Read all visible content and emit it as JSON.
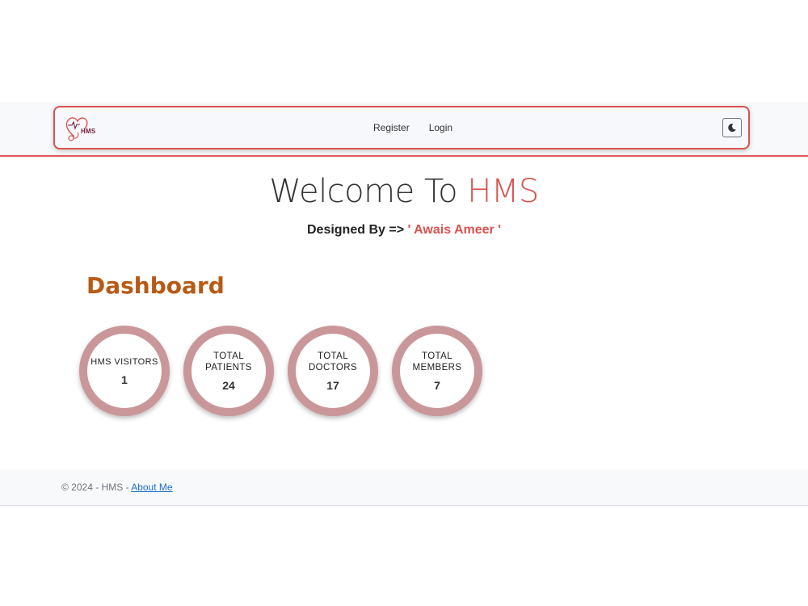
{
  "navbar": {
    "brand_text": "HMS",
    "links": [
      "Register",
      "Login"
    ],
    "theme_toggle_icon": "moon-icon"
  },
  "hero": {
    "welcome_prefix": "Welcome To ",
    "welcome_highlight": "HMS",
    "designed_prefix": "Designed By => ",
    "designed_name": "' Awais Ameer '"
  },
  "dashboard": {
    "title": "Dashboard",
    "stats": [
      {
        "label": "HMS VISITORS",
        "value": "1"
      },
      {
        "label": "TOTAL PATIENTS",
        "value": "24"
      },
      {
        "label": "TOTAL DOCTORS",
        "value": "17"
      },
      {
        "label": "TOTAL MEMBERS",
        "value": "7"
      }
    ]
  },
  "footer": {
    "copyright": "© 2024 - HMS - ",
    "about_link": "About Me"
  },
  "colors": {
    "accent": "#d9534f",
    "dashboard_title": "#b85a14",
    "stat_ring": "#c9979a",
    "link": "#1a6fc9"
  }
}
